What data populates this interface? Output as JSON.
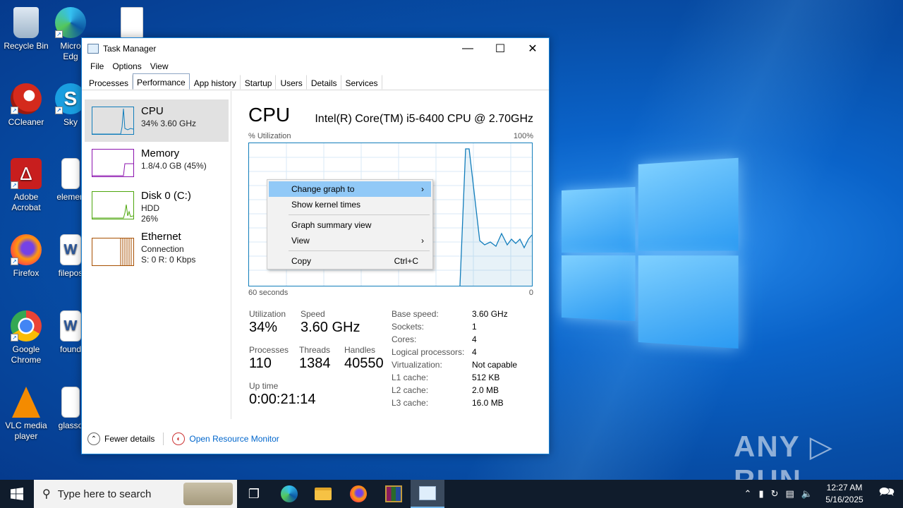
{
  "desktop": {
    "icons": [
      {
        "label": "Recycle Bin",
        "name": "recycle-bin-icon"
      },
      {
        "label": "Micro Edg",
        "name": "edge-icon"
      },
      {
        "label": "",
        "name": "image-file-icon"
      },
      {
        "label": "CCleaner",
        "name": "ccleaner-icon"
      },
      {
        "label": "Sky",
        "name": "skype-icon"
      },
      {
        "label": "Adobe Acrobat",
        "name": "acrobat-icon"
      },
      {
        "label": "elemen",
        "name": "element-file-icon"
      },
      {
        "label": "Firefox",
        "name": "firefox-icon"
      },
      {
        "label": "filepos",
        "name": "word-file-icon"
      },
      {
        "label": "Google Chrome",
        "name": "chrome-icon"
      },
      {
        "label": "found",
        "name": "word-file-icon-2"
      },
      {
        "label": "VLC media player",
        "name": "vlc-icon"
      },
      {
        "label": "glasso",
        "name": "glass-file-icon"
      }
    ],
    "watermark": "ANY ▷ RUN"
  },
  "window": {
    "title": "Task Manager",
    "menu": [
      "File",
      "Options",
      "View"
    ],
    "tabs": [
      "Processes",
      "Performance",
      "App history",
      "Startup",
      "Users",
      "Details",
      "Services"
    ],
    "active_tab": "Performance"
  },
  "sidebar": [
    {
      "title": "CPU",
      "line1": "34%  3.60 GHz",
      "line2": "",
      "color": "#117dbb"
    },
    {
      "title": "Memory",
      "line1": "1.8/4.0 GB (45%)",
      "line2": "",
      "color": "#8b12ae"
    },
    {
      "title": "Disk 0 (C:)",
      "line1": "HDD",
      "line2": "26%",
      "color": "#4da60c"
    },
    {
      "title": "Ethernet",
      "line1": "Connection",
      "line2": "S: 0  R: 0 Kbps",
      "color": "#a74f01"
    }
  ],
  "cpu": {
    "title": "CPU",
    "model": "Intel(R) Core(TM) i5-6400 CPU @ 2.70GHz",
    "util_label": "% Utilization",
    "max_label": "100%",
    "time_label": "60 seconds",
    "zero_label": "0",
    "stats": {
      "utilization_label": "Utilization",
      "utilization": "34%",
      "speed_label": "Speed",
      "speed": "3.60 GHz",
      "processes_label": "Processes",
      "processes": "110",
      "threads_label": "Threads",
      "threads": "1384",
      "handles_label": "Handles",
      "handles": "40550",
      "uptime_label": "Up time",
      "uptime": "0:00:21:14"
    },
    "specs": [
      {
        "label": "Base speed:",
        "value": "3.60 GHz"
      },
      {
        "label": "Sockets:",
        "value": "1"
      },
      {
        "label": "Cores:",
        "value": "4"
      },
      {
        "label": "Logical processors:",
        "value": "4"
      },
      {
        "label": "Virtualization:",
        "value": "Not capable"
      },
      {
        "label": "L1 cache:",
        "value": "512 KB"
      },
      {
        "label": "L2 cache:",
        "value": "2.0 MB"
      },
      {
        "label": "L3 cache:",
        "value": "16.0 MB"
      }
    ]
  },
  "context_menu": {
    "change_graph": "Change graph to",
    "kernel": "Show kernel times",
    "summary": "Graph summary view",
    "view": "View",
    "copy": "Copy",
    "copy_shortcut": "Ctrl+C"
  },
  "footer": {
    "fewer": "Fewer details",
    "resource_monitor": "Open Resource Monitor"
  },
  "taskbar": {
    "search_placeholder": "Type here to search",
    "time": "12:27 AM",
    "date": "5/16/2025"
  }
}
